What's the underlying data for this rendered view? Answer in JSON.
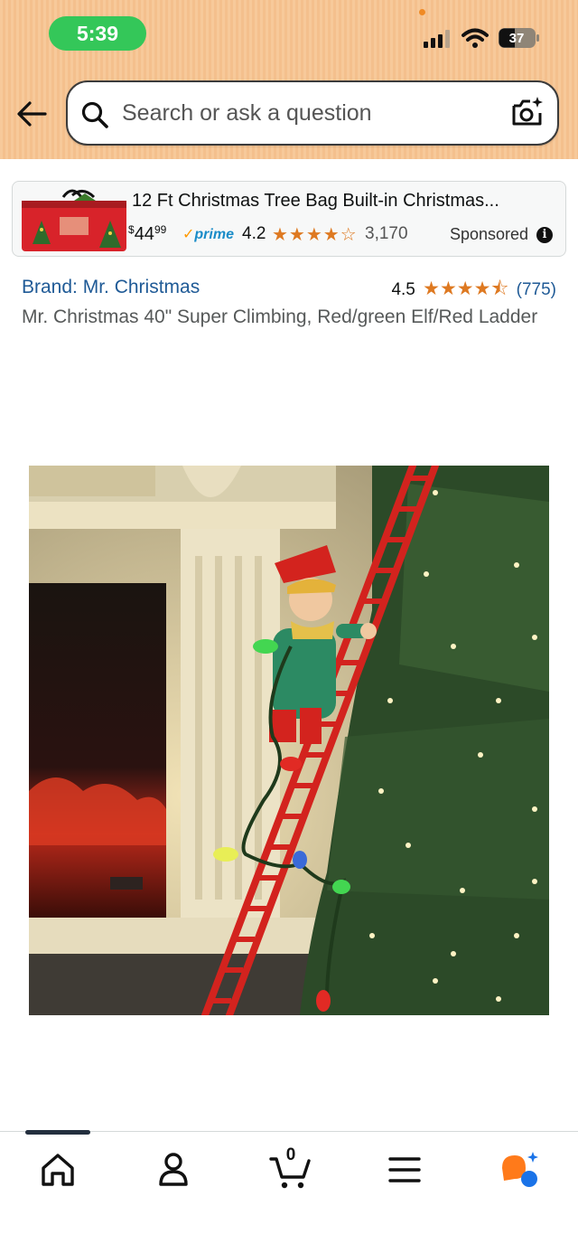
{
  "status_bar": {
    "time": "5:39",
    "battery_level": "37"
  },
  "header": {
    "search_placeholder": "Search or ask a question",
    "icons": [
      "back-arrow-icon",
      "search-icon",
      "camera-search-icon"
    ]
  },
  "ad": {
    "title": "12 Ft Christmas Tree Bag Built-in Christmas...",
    "price_currency": "$",
    "price_whole": "44",
    "price_fraction": "99",
    "prime_label": "prime",
    "rating": "4.2",
    "stars": "★★★★☆",
    "review_count": "3,170",
    "sponsored_label": "Sponsored",
    "info_icon_glyph": "i"
  },
  "product": {
    "brand": "Brand: Mr. Christmas",
    "rating": "4.5",
    "stars": "★★★★⯪",
    "review_count": "(775)",
    "title": "Mr. Christmas 40\" Super Climbing, Red/green Elf/Red Ladder"
  },
  "bottom_nav": {
    "cart_count": "0",
    "items": [
      "home-icon",
      "account-icon",
      "cart-icon",
      "menu-icon",
      "rufus-icon"
    ]
  },
  "colors": {
    "header_bg": "#f7c99a",
    "link_blue": "#1f5a96",
    "star_orange": "#de7921",
    "time_pill_green": "#34c759"
  }
}
